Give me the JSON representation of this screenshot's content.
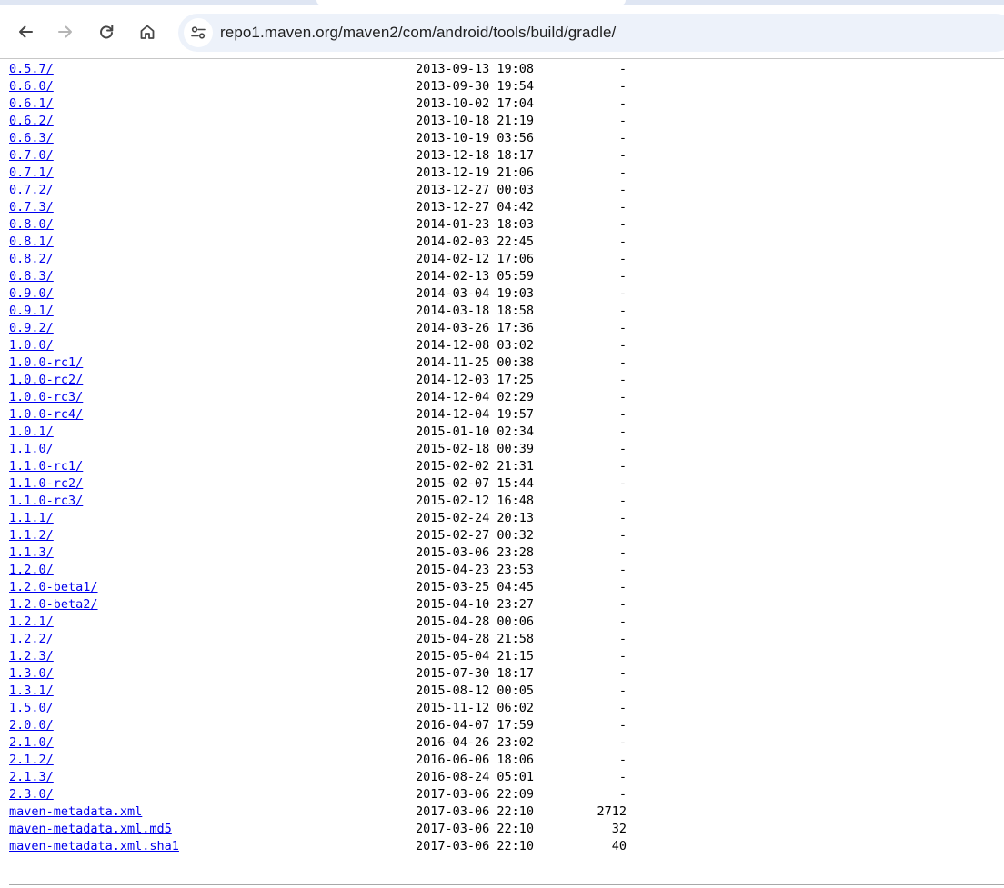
{
  "browser": {
    "url": "repo1.maven.org/maven2/com/android/tools/build/gradle/",
    "back_icon": "arrow-left-icon",
    "forward_icon": "arrow-right-icon",
    "reload_icon": "reload-icon",
    "home_icon": "home-icon",
    "site_info_icon": "tune-icon"
  },
  "entries": [
    {
      "name": "0.5.7/",
      "date": "2013-09-13 19:08",
      "size": "-"
    },
    {
      "name": "0.6.0/",
      "date": "2013-09-30 19:54",
      "size": "-"
    },
    {
      "name": "0.6.1/",
      "date": "2013-10-02 17:04",
      "size": "-"
    },
    {
      "name": "0.6.2/",
      "date": "2013-10-18 21:19",
      "size": "-"
    },
    {
      "name": "0.6.3/",
      "date": "2013-10-19 03:56",
      "size": "-"
    },
    {
      "name": "0.7.0/",
      "date": "2013-12-18 18:17",
      "size": "-"
    },
    {
      "name": "0.7.1/",
      "date": "2013-12-19 21:06",
      "size": "-"
    },
    {
      "name": "0.7.2/",
      "date": "2013-12-27 00:03",
      "size": "-"
    },
    {
      "name": "0.7.3/",
      "date": "2013-12-27 04:42",
      "size": "-"
    },
    {
      "name": "0.8.0/",
      "date": "2014-01-23 18:03",
      "size": "-"
    },
    {
      "name": "0.8.1/",
      "date": "2014-02-03 22:45",
      "size": "-"
    },
    {
      "name": "0.8.2/",
      "date": "2014-02-12 17:06",
      "size": "-"
    },
    {
      "name": "0.8.3/",
      "date": "2014-02-13 05:59",
      "size": "-"
    },
    {
      "name": "0.9.0/",
      "date": "2014-03-04 19:03",
      "size": "-"
    },
    {
      "name": "0.9.1/",
      "date": "2014-03-18 18:58",
      "size": "-"
    },
    {
      "name": "0.9.2/",
      "date": "2014-03-26 17:36",
      "size": "-"
    },
    {
      "name": "1.0.0/",
      "date": "2014-12-08 03:02",
      "size": "-"
    },
    {
      "name": "1.0.0-rc1/",
      "date": "2014-11-25 00:38",
      "size": "-"
    },
    {
      "name": "1.0.0-rc2/",
      "date": "2014-12-03 17:25",
      "size": "-"
    },
    {
      "name": "1.0.0-rc3/",
      "date": "2014-12-04 02:29",
      "size": "-"
    },
    {
      "name": "1.0.0-rc4/",
      "date": "2014-12-04 19:57",
      "size": "-"
    },
    {
      "name": "1.0.1/",
      "date": "2015-01-10 02:34",
      "size": "-"
    },
    {
      "name": "1.1.0/",
      "date": "2015-02-18 00:39",
      "size": "-"
    },
    {
      "name": "1.1.0-rc1/",
      "date": "2015-02-02 21:31",
      "size": "-"
    },
    {
      "name": "1.1.0-rc2/",
      "date": "2015-02-07 15:44",
      "size": "-"
    },
    {
      "name": "1.1.0-rc3/",
      "date": "2015-02-12 16:48",
      "size": "-"
    },
    {
      "name": "1.1.1/",
      "date": "2015-02-24 20:13",
      "size": "-"
    },
    {
      "name": "1.1.2/",
      "date": "2015-02-27 00:32",
      "size": "-"
    },
    {
      "name": "1.1.3/",
      "date": "2015-03-06 23:28",
      "size": "-"
    },
    {
      "name": "1.2.0/",
      "date": "2015-04-23 23:53",
      "size": "-"
    },
    {
      "name": "1.2.0-beta1/",
      "date": "2015-03-25 04:45",
      "size": "-"
    },
    {
      "name": "1.2.0-beta2/",
      "date": "2015-04-10 23:27",
      "size": "-"
    },
    {
      "name": "1.2.1/",
      "date": "2015-04-28 00:06",
      "size": "-"
    },
    {
      "name": "1.2.2/",
      "date": "2015-04-28 21:58",
      "size": "-"
    },
    {
      "name": "1.2.3/",
      "date": "2015-05-04 21:15",
      "size": "-"
    },
    {
      "name": "1.3.0/",
      "date": "2015-07-30 18:17",
      "size": "-"
    },
    {
      "name": "1.3.1/",
      "date": "2015-08-12 00:05",
      "size": "-"
    },
    {
      "name": "1.5.0/",
      "date": "2015-11-12 06:02",
      "size": "-"
    },
    {
      "name": "2.0.0/",
      "date": "2016-04-07 17:59",
      "size": "-"
    },
    {
      "name": "2.1.0/",
      "date": "2016-04-26 23:02",
      "size": "-"
    },
    {
      "name": "2.1.2/",
      "date": "2016-06-06 18:06",
      "size": "-"
    },
    {
      "name": "2.1.3/",
      "date": "2016-08-24 05:01",
      "size": "-"
    },
    {
      "name": "2.3.0/",
      "date": "2017-03-06 22:09",
      "size": "-"
    },
    {
      "name": "maven-metadata.xml",
      "date": "2017-03-06 22:10",
      "size": "2712"
    },
    {
      "name": "maven-metadata.xml.md5",
      "date": "2017-03-06 22:10",
      "size": "32"
    },
    {
      "name": "maven-metadata.xml.sha1",
      "date": "2017-03-06 22:10",
      "size": "40"
    }
  ]
}
